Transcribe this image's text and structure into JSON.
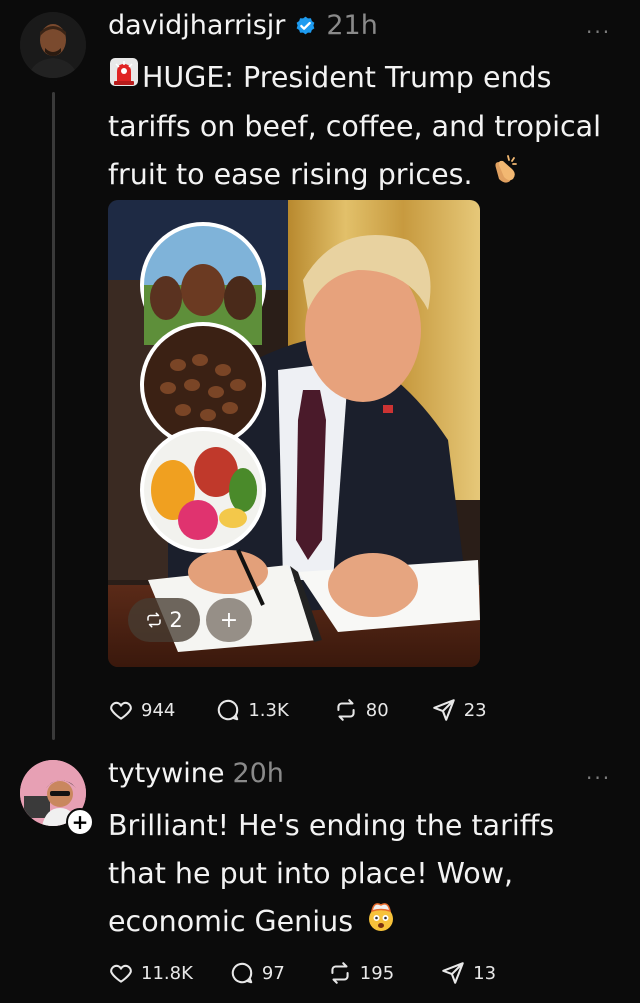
{
  "post": {
    "username": "davidjharrisjr",
    "time": "21h",
    "more": "···",
    "text_lines": [
      "HUGE: President Trump ends",
      "tariffs on beef, coffee, and tropical",
      "fruit to ease rising prices."
    ],
    "stats": {
      "likes": "944",
      "replies": "1.3K",
      "reposts": "80",
      "shares": "23"
    },
    "media": {
      "repost_count": "2",
      "add_label": "+"
    }
  },
  "reply": {
    "username": "tytywine",
    "time": "20h",
    "more": "···",
    "follow_label": "+",
    "text_lines": [
      "Brilliant!  He's ending the tariffs",
      "that he put into place!  Wow,",
      "economic Genius"
    ],
    "stats": {
      "likes": "11.8K",
      "replies": "97",
      "reposts": "195",
      "shares": "13"
    }
  },
  "colors": {
    "verified": "#1d9bf0",
    "background": "#0b0b0b",
    "muted": "#8a8a8a"
  },
  "icons": [
    "siren-emoji",
    "clapping-hands-emoji",
    "exploding-head-emoji",
    "heart-icon",
    "comment-icon",
    "repost-icon",
    "share-icon",
    "verified-icon"
  ]
}
